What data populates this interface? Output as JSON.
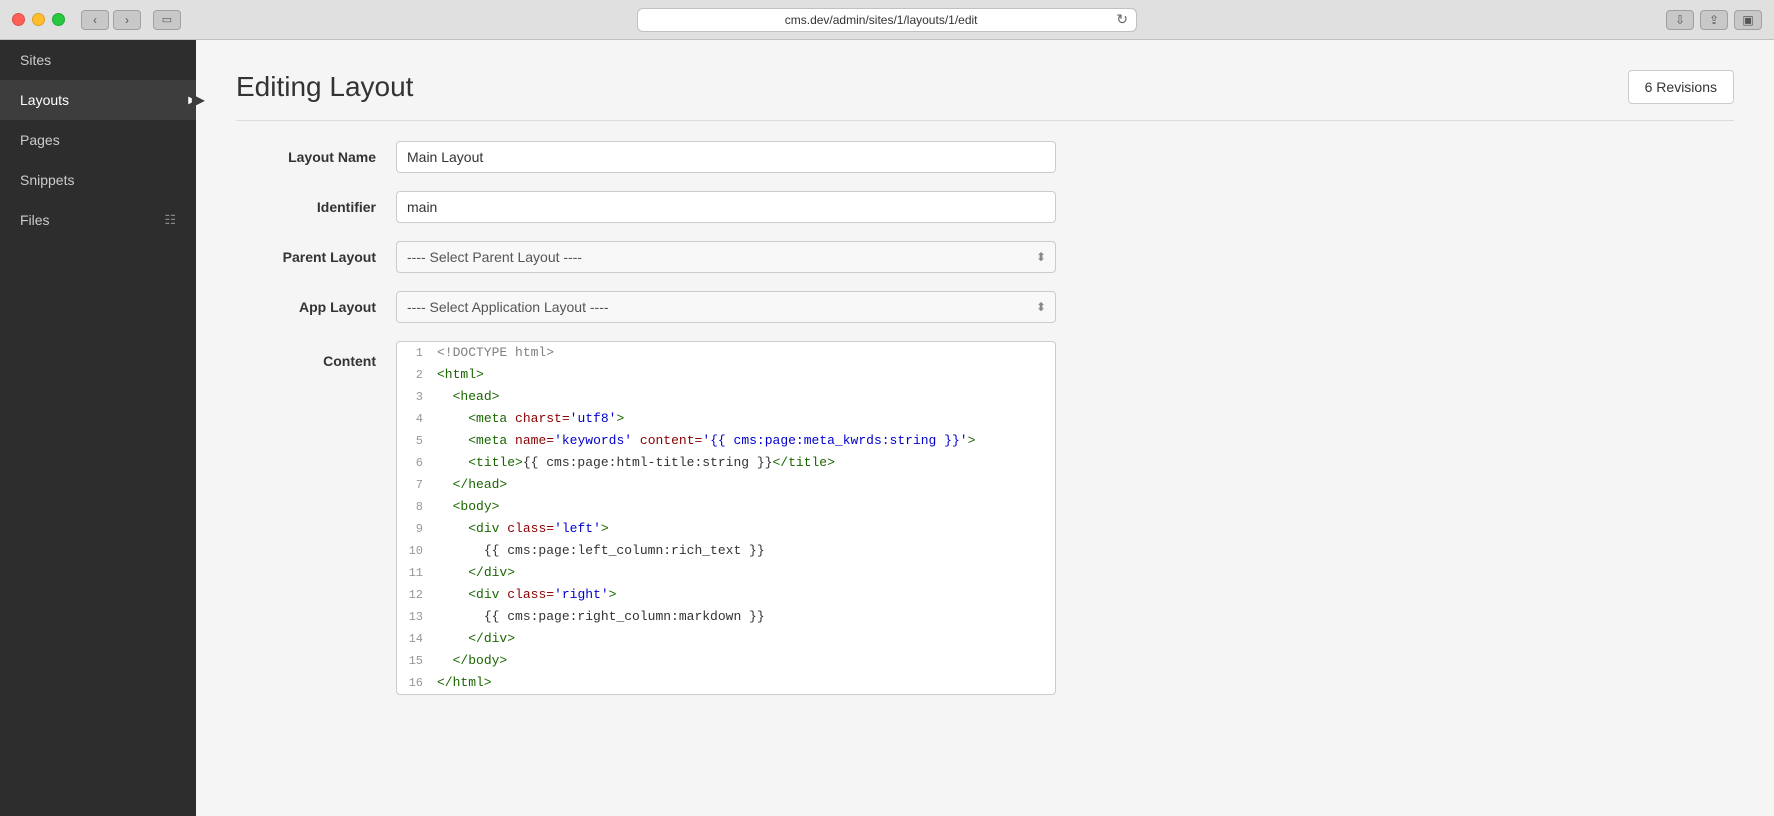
{
  "window": {
    "url": "cms.dev/admin/sites/1/layouts/1/edit"
  },
  "sidebar": {
    "items": [
      {
        "id": "sites",
        "label": "Sites",
        "active": false
      },
      {
        "id": "layouts",
        "label": "Layouts",
        "active": true
      },
      {
        "id": "pages",
        "label": "Pages",
        "active": false
      },
      {
        "id": "snippets",
        "label": "Snippets",
        "active": false
      },
      {
        "id": "files",
        "label": "Files",
        "active": false
      }
    ]
  },
  "header": {
    "title": "Editing Layout",
    "revisions_button": "6 Revisions"
  },
  "form": {
    "layout_name_label": "Layout Name",
    "layout_name_value": "Main Layout",
    "identifier_label": "Identifier",
    "identifier_value": "main",
    "parent_layout_label": "Parent Layout",
    "parent_layout_placeholder": "---- Select Parent Layout ----",
    "app_layout_label": "App Layout",
    "app_layout_placeholder": "---- Select Application Layout ----",
    "content_label": "Content"
  },
  "code_lines": [
    {
      "num": "1",
      "html": "<span class='c-doctype'>&lt;!DOCTYPE html&gt;</span>"
    },
    {
      "num": "2",
      "html": "<span class='c-tag'>&lt;html&gt;</span>"
    },
    {
      "num": "3",
      "html": "  <span class='c-tag'>&lt;head&gt;</span>"
    },
    {
      "num": "4",
      "html": "    <span class='c-tag'>&lt;meta</span> <span class='c-attr'>charst=</span><span class='c-val'>'utf8'</span><span class='c-tag'>&gt;</span>"
    },
    {
      "num": "5",
      "html": "    <span class='c-tag'>&lt;meta</span> <span class='c-attr'>name=</span><span class='c-val'>'keywords'</span> <span class='c-attr'>content=</span><span class='c-val'>'{{ cms:page:meta_kwrds:string }}'</span><span class='c-tag'>&gt;</span>"
    },
    {
      "num": "6",
      "html": "    <span class='c-tag'>&lt;title&gt;</span><span class='c-text'>{{ cms:page:html-title:string }}</span><span class='c-tag'>&lt;/title&gt;</span>"
    },
    {
      "num": "7",
      "html": "  <span class='c-tag'>&lt;/head&gt;</span>"
    },
    {
      "num": "8",
      "html": "  <span class='c-tag'>&lt;body&gt;</span>"
    },
    {
      "num": "9",
      "html": "    <span class='c-tag'>&lt;div</span> <span class='c-attr'>class=</span><span class='c-val'>'left'</span><span class='c-tag'>&gt;</span>"
    },
    {
      "num": "10",
      "html": "      <span class='c-text'>{{ cms:page:left_column:rich_text }}</span>"
    },
    {
      "num": "11",
      "html": "    <span class='c-tag'>&lt;/div&gt;</span>"
    },
    {
      "num": "12",
      "html": "    <span class='c-tag'>&lt;div</span> <span class='c-attr'>class=</span><span class='c-val'>'right'</span><span class='c-tag'>&gt;</span>"
    },
    {
      "num": "13",
      "html": "      <span class='c-text'>{{ cms:page:right_column:markdown }}</span>"
    },
    {
      "num": "14",
      "html": "    <span class='c-tag'>&lt;/div&gt;</span>"
    },
    {
      "num": "15",
      "html": "  <span class='c-tag'>&lt;/body&gt;</span>"
    },
    {
      "num": "16",
      "html": "<span class='c-tag'>&lt;/html&gt;</span>"
    }
  ]
}
